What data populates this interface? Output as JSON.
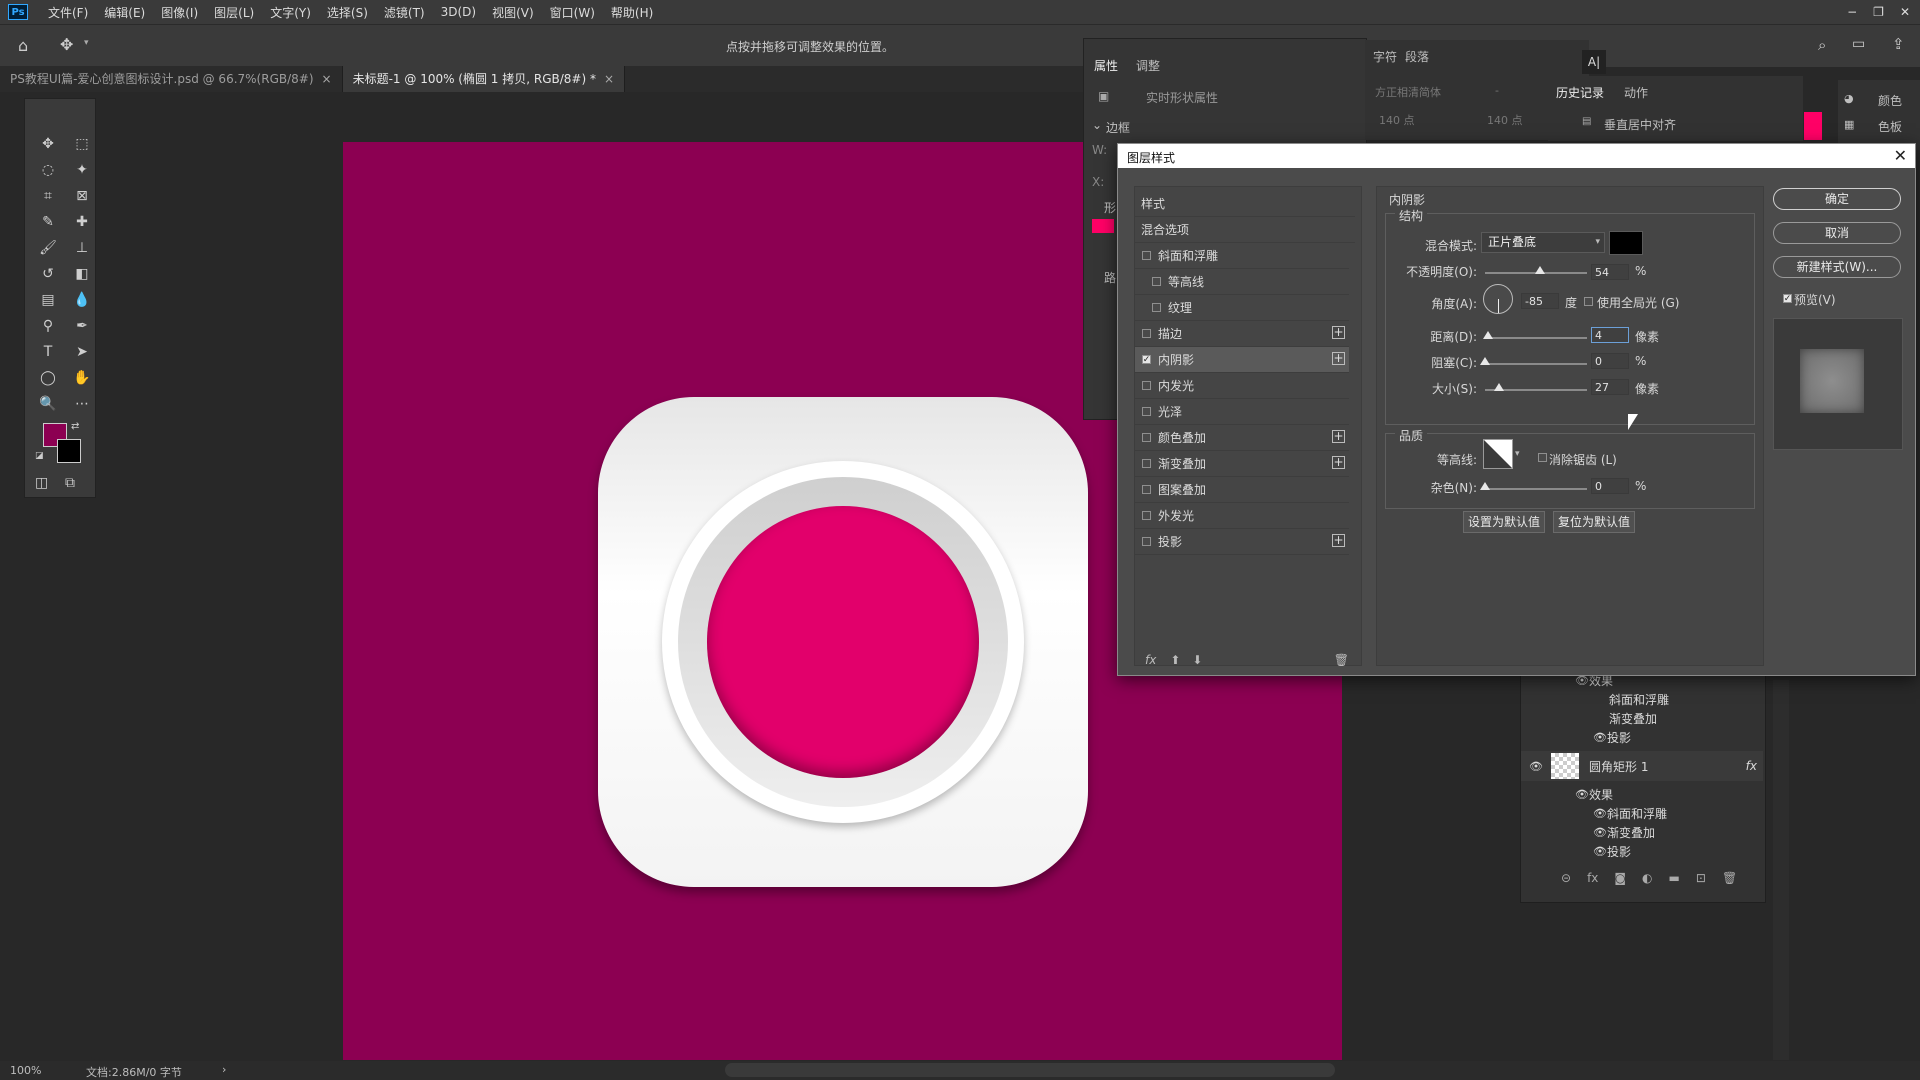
{
  "app": {
    "logo": "Ps",
    "menu": [
      "文件(F)",
      "编辑(E)",
      "图像(I)",
      "图层(L)",
      "文字(Y)",
      "选择(S)",
      "滤镜(T)",
      "3D(D)",
      "视图(V)",
      "窗口(W)",
      "帮助(H)"
    ],
    "window_controls": [
      "−",
      "❐",
      "✕"
    ]
  },
  "options_bar": {
    "hint": "点按并拖移可调整效果的位置。"
  },
  "doc_tabs": [
    {
      "label": "PS教程UI篇-爱心创意图标设计.psd @ 66.7%(RGB/8#)",
      "close": "×"
    },
    {
      "label": "未标题-1 @ 100% (椭圆 1 拷贝, RGB/8#) *",
      "close": "×"
    }
  ],
  "tools": {
    "foreground_color": "#8c0052",
    "background_color": "#000000"
  },
  "canvas": {
    "background_color": "#8c0052",
    "circle_color": "#e2006b"
  },
  "status_bar": {
    "zoom": "100%",
    "doc_info": "文档:2.86M/0 字节"
  },
  "properties_panel": {
    "tabs": [
      "属性",
      "调整"
    ],
    "subtitle": "实时形状属性",
    "section": "边框",
    "w_label": "W:",
    "x_label": "X:",
    "shape_label": "形",
    "path_label": "路",
    "fill_color": "#ff0066"
  },
  "character_panel": {
    "tabs": [
      "字符",
      "段落"
    ],
    "font_family": "方正相清简体",
    "font_style": "-",
    "size": "140 点",
    "leading": "140 点",
    "ai_label": "A|"
  },
  "history_panel": {
    "tabs": [
      "历史记录",
      "动作"
    ],
    "item": "垂直居中对齐",
    "swatch": "#ff0066"
  },
  "color_panel": {
    "items": [
      "颜色",
      "色板"
    ]
  },
  "layers_panel": {
    "rows": [
      {
        "label": "效果",
        "level": 1
      },
      {
        "label": "斜面和浮雕",
        "level": 2
      },
      {
        "label": "渐变叠加",
        "level": 2
      },
      {
        "label": "投影",
        "level": 2
      }
    ],
    "layer_name": "圆角矩形 1",
    "layer_fx": "fx",
    "rows2": [
      {
        "label": "效果",
        "level": 1
      },
      {
        "label": "斜面和浮雕",
        "level": 2
      },
      {
        "label": "渐变叠加",
        "level": 2
      },
      {
        "label": "投影",
        "level": 2
      }
    ],
    "footer_icons": [
      "⊝",
      "fx",
      "◙",
      "◐",
      "▬",
      "⊡",
      "🗑"
    ]
  },
  "dialog": {
    "title": "图层样式",
    "close": "✕",
    "styles_header": "样式",
    "blend_options": "混合选项",
    "style_items": [
      {
        "label": "斜面和浮雕",
        "checked": false,
        "indent": false,
        "plus": false
      },
      {
        "label": "等高线",
        "checked": false,
        "indent": true,
        "plus": false
      },
      {
        "label": "纹理",
        "checked": false,
        "indent": true,
        "plus": false
      },
      {
        "label": "描边",
        "checked": false,
        "indent": false,
        "plus": true
      },
      {
        "label": "内阴影",
        "checked": true,
        "indent": false,
        "plus": true
      },
      {
        "label": "内发光",
        "checked": false,
        "indent": false,
        "plus": false
      },
      {
        "label": "光泽",
        "checked": false,
        "indent": false,
        "plus": false
      },
      {
        "label": "颜色叠加",
        "checked": false,
        "indent": false,
        "plus": true
      },
      {
        "label": "渐变叠加",
        "checked": false,
        "indent": false,
        "plus": true
      },
      {
        "label": "图案叠加",
        "checked": false,
        "indent": false,
        "plus": false
      },
      {
        "label": "外发光",
        "checked": false,
        "indent": false,
        "plus": false
      },
      {
        "label": "投影",
        "checked": false,
        "indent": false,
        "plus": true
      }
    ],
    "footer_icons": [
      "fx",
      "⬆",
      "⬇",
      "🗑"
    ],
    "inner_shadow": {
      "section_title": "内阴影",
      "structure_title": "结构",
      "blend_mode_label": "混合模式:",
      "blend_mode_value": "正片叠底",
      "shadow_color": "#000000",
      "opacity_label": "不透明度(O):",
      "opacity_value": "54",
      "opacity_unit": "%",
      "opacity_level": 0.54,
      "angle_label": "角度(A):",
      "angle_value": "-85",
      "angle_unit": "度",
      "global_light_label": "使用全局光 (G)",
      "distance_label": "距离(D):",
      "distance_value": "4",
      "distance_unit": "像素",
      "choke_label": "阻塞(C):",
      "choke_value": "0",
      "choke_unit": "%",
      "size_label": "大小(S):",
      "size_value": "27",
      "size_unit": "像素",
      "quality_title": "品质",
      "contour_label": "等高线:",
      "antialias_label": "消除锯齿 (L)",
      "noise_label": "杂色(N):",
      "noise_value": "0",
      "noise_unit": "%",
      "set_default_button": "设置为默认值",
      "reset_default_button": "复位为默认值"
    },
    "ok_button": "确定",
    "cancel_button": "取消",
    "new_style_button": "新建样式(W)...",
    "preview_label": "预览(V)"
  }
}
